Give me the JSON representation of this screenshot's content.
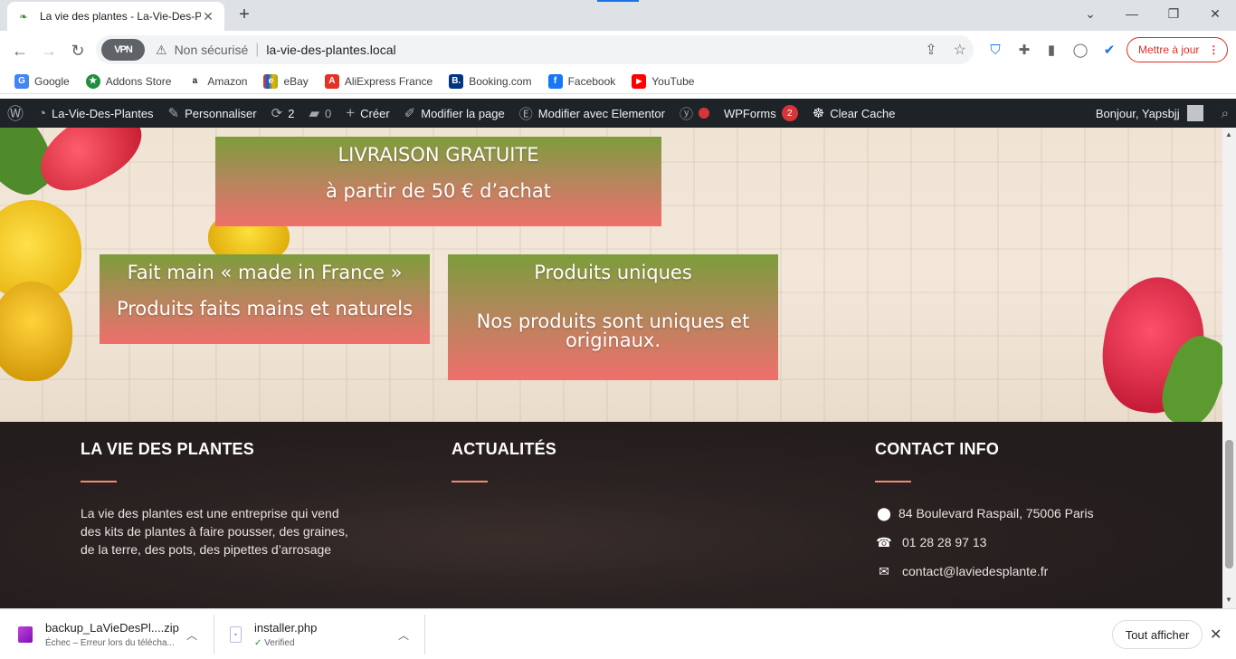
{
  "browser": {
    "tab_title": "La vie des plantes - La-Vie-Des-P",
    "new_tab": "+",
    "security_label": "Non sécurisé",
    "url": "la-vie-des-plantes.local",
    "vpn_label": "VPN",
    "update_label": "Mettre à jour"
  },
  "bookmarks": [
    {
      "label": "Google",
      "color": "#4285f4",
      "icon": "G"
    },
    {
      "label": "Addons Store",
      "color": "#1e8e3e",
      "icon": "★"
    },
    {
      "label": "Amazon",
      "color": "#222222",
      "icon": "a"
    },
    {
      "label": "eBay",
      "color": "#e53238",
      "icon": "e"
    },
    {
      "label": "AliExpress France",
      "color": "#e43225",
      "icon": "A"
    },
    {
      "label": "Booking.com",
      "color": "#003580",
      "icon": "B."
    },
    {
      "label": "Facebook",
      "color": "#1877f2",
      "icon": "f"
    },
    {
      "label": "YouTube",
      "color": "#ff0000",
      "icon": "▶"
    }
  ],
  "wpbar": {
    "site_name": "La-Vie-Des-Plantes",
    "customize": "Personnaliser",
    "updates_count": "2",
    "comments_count": "0",
    "create": "Créer",
    "edit_page": "Modifier la page",
    "edit_elementor": "Modifier avec Elementor",
    "wpforms": "WPForms",
    "wpforms_count": "2",
    "clear_cache": "Clear Cache",
    "greeting": "Bonjour, Yapsbjj"
  },
  "promos": {
    "shipping": {
      "line1": "LIVRAISON GRATUITE",
      "line2": "à partir de 50 € d’achat"
    },
    "handmade": {
      "line1": "Fait main « made in France »",
      "line2": "Produits faits mains et naturels"
    },
    "unique": {
      "line1": "Produits uniques",
      "line2": "Nos produits sont uniques et originaux."
    }
  },
  "footer": {
    "about": {
      "title": "LA VIE DES PLANTES",
      "text": "La vie des plantes est une entreprise qui vend des kits de plantes à faire pousser, des graines, de la terre, des pots, des pipettes d’arrosage"
    },
    "news": {
      "title": "ACTUALITÉS"
    },
    "contact": {
      "title": "CONTACT INFO",
      "address": "84 Boulevard Raspail, 75006 Paris",
      "phone": "01 28 28 97 13",
      "email": "contact@laviedesplante.fr"
    },
    "accent_color": "#f08a70"
  },
  "downloads": [
    {
      "name": "backup_LaVieDesPl....zip",
      "status": "Échec – Erreur lors du télécha...",
      "icon_color": "#a020c0"
    },
    {
      "name": "installer.php",
      "status": "Verified",
      "icon_color": "#7a5cc4"
    }
  ],
  "download_bar": {
    "show_all": "Tout afficher"
  }
}
